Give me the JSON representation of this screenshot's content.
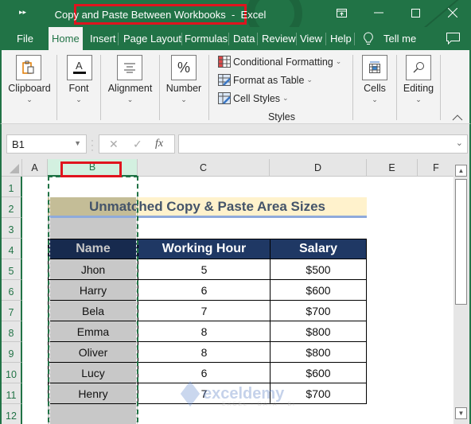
{
  "window": {
    "title": "Copy and Paste Between Workbooks  -  Excel",
    "controls": [
      "ribbon-display-options",
      "minimize",
      "maximize",
      "close"
    ]
  },
  "tabs": [
    {
      "label": "File",
      "active": false
    },
    {
      "label": "Home",
      "active": true
    },
    {
      "label": "Insert",
      "active": false
    },
    {
      "label": "Page Layout",
      "active": false
    },
    {
      "label": "Formulas",
      "active": false
    },
    {
      "label": "Data",
      "active": false
    },
    {
      "label": "Review",
      "active": false
    },
    {
      "label": "View",
      "active": false
    },
    {
      "label": "Help",
      "active": false
    }
  ],
  "tell_me": "Tell me",
  "ribbon": {
    "groups": [
      {
        "label": "Clipboard",
        "icon": "clipboard-icon"
      },
      {
        "label": "Font",
        "icon": "font-color-icon"
      },
      {
        "label": "Alignment",
        "icon": "align-center-icon"
      },
      {
        "label": "Number",
        "icon": "percent-icon"
      }
    ],
    "styles": {
      "items": [
        "Conditional Formatting",
        "Format as Table",
        "Cell Styles"
      ],
      "group_label": "Styles"
    },
    "cells_label": "Cells",
    "editing_label": "Editing"
  },
  "formula_bar": {
    "name_box": "B1",
    "fx_label": "fx",
    "formula": ""
  },
  "columns": [
    "A",
    "B",
    "C",
    "D",
    "E",
    "F"
  ],
  "selected_column": "B",
  "rows": [
    "1",
    "2",
    "3",
    "4",
    "5",
    "6",
    "7",
    "8",
    "9",
    "10",
    "11",
    "12"
  ],
  "sheet": {
    "title": "Unmatched Copy & Paste Area Sizes",
    "headers": [
      "Name",
      "Working Hour",
      "Salary"
    ],
    "data": [
      [
        "Jhon",
        "5",
        "$500"
      ],
      [
        "Harry",
        "6",
        "$600"
      ],
      [
        "Bela",
        "7",
        "$700"
      ],
      [
        "Emma",
        "8",
        "$800"
      ],
      [
        "Oliver",
        "8",
        "$800"
      ],
      [
        "Lucy",
        "6",
        "$600"
      ],
      [
        "Henry",
        "7",
        "$700"
      ]
    ]
  },
  "watermark": {
    "name": "exceldemy",
    "tagline": "EXCEL · DATA · BI"
  },
  "colors": {
    "excel_green": "#217346",
    "highlight_red": "#e0141e",
    "table_header": "#1f3864",
    "title_fill": "#fff2cc",
    "title_text": "#44546a",
    "selection_gray": "#c8c8c8"
  }
}
